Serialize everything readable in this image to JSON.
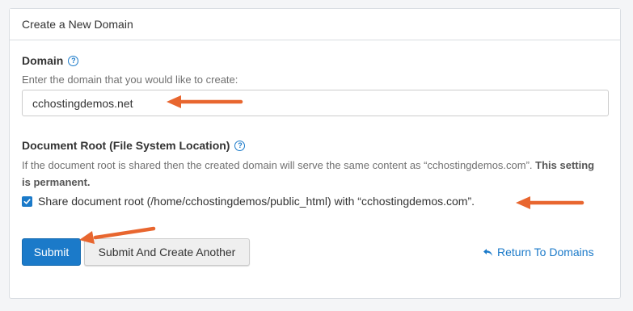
{
  "panel": {
    "title": "Create a New Domain"
  },
  "domain": {
    "label": "Domain",
    "hint": "Enter the domain that you would like to create:",
    "value": "cchostingdemos.net",
    "help_icon": "question-circle-icon"
  },
  "docroot": {
    "label": "Document Root (File System Location)",
    "description": "If the document root is shared then the created domain will serve the same content as “cchostingdemos.com”.",
    "permanent_note": "This setting is permanent.",
    "checkbox_label": "Share document root (/home/cchostingdemos/public_html) with “cchostingdemos.com”.",
    "checkbox_checked": true,
    "help_icon": "question-circle-icon"
  },
  "actions": {
    "submit_label": "Submit",
    "submit_another_label": "Submit And Create Another",
    "return_label": "Return To Domains",
    "return_icon": "undo-arrow-icon"
  },
  "colors": {
    "accent": "#1b7ac9",
    "annotation_arrow": "#e8662f"
  }
}
